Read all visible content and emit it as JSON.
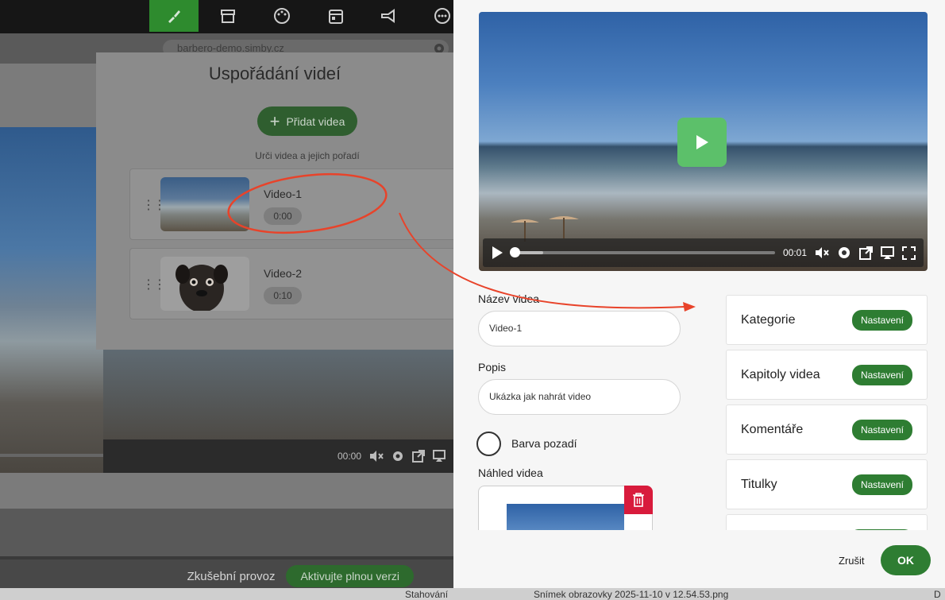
{
  "editor": {
    "url": "barbero-demo.simby.cz",
    "toolbar": [
      "paintbrush-icon",
      "store-icon",
      "palette-icon",
      "calendar-icon",
      "megaphone-icon",
      "dots-icon"
    ],
    "bg_time": "00:00",
    "trial_text": "Zkušební provoz",
    "trial_button": "Aktivujte plnou verzi"
  },
  "modal": {
    "title": "Uspořádání videí",
    "add_button": "Přidat videa",
    "subtitle": "Urči videa a jejich pořadí",
    "videos": [
      {
        "name": "Video-1",
        "duration": "0:00"
      },
      {
        "name": "Video-2",
        "duration": "0:10"
      }
    ]
  },
  "player": {
    "time": "00:01",
    "progress": 0.12
  },
  "form": {
    "name_label": "Název videa",
    "name_value": "Video-1",
    "desc_label": "Popis",
    "desc_value": "Ukázka jak nahrát video",
    "bg_color_label": "Barva pozadí",
    "preview_label": "Náhled videa"
  },
  "settings": {
    "button_label": "Nastavení",
    "items": [
      "Kategorie",
      "Kapitoly videa",
      "Komentáře",
      "Titulky"
    ]
  },
  "footer": {
    "cancel": "Zrušit",
    "ok": "OK"
  },
  "taskbar": {
    "item1": "Stahování",
    "item2": "Snímek obrazovky 2025-11-10 v 12.54.53.png",
    "item3": "D"
  },
  "colors": {
    "accent_green": "#2e7d32",
    "play_green": "#5cc06a",
    "delete_red": "#d81b3c",
    "annotation_red": "#e8432a"
  }
}
